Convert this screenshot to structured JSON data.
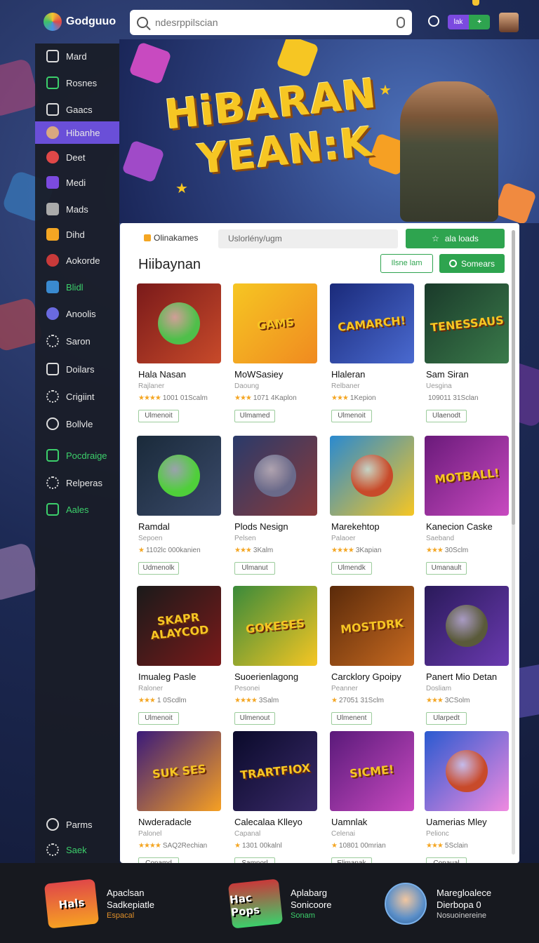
{
  "app": {
    "logo_text": "Godguuo"
  },
  "search": {
    "placeholder": "ndesrppilscian"
  },
  "topbar": {
    "pill_left": "lak",
    "pill_right": "+"
  },
  "sidebar": {
    "items": [
      {
        "label": "Mard",
        "icon": "home-icon"
      },
      {
        "label": "Rosnes",
        "icon": "monitor-icon"
      },
      {
        "label": "Gaacs",
        "icon": "house-icon"
      },
      {
        "label": "Hibanhe",
        "icon": "avatar-icon"
      },
      {
        "label": "Deet",
        "icon": "heart-icon"
      },
      {
        "label": "Medi",
        "icon": "dice-icon"
      },
      {
        "label": "Mads",
        "icon": "grid-icon"
      },
      {
        "label": "Dihd",
        "icon": "gift-icon"
      },
      {
        "label": "Aokorde",
        "icon": "rose-icon"
      },
      {
        "label": "Blidl",
        "icon": "blocks-icon"
      },
      {
        "label": "Anoolis",
        "icon": "heart-blue-icon"
      },
      {
        "label": "Saron",
        "icon": "gear-icon"
      },
      {
        "label": "Doilars",
        "icon": "list-icon"
      },
      {
        "label": "Crigiint",
        "icon": "settings-icon"
      },
      {
        "label": "Bollvle",
        "icon": "clock-icon"
      },
      {
        "label": "Pocdraige",
        "icon": "folder-icon"
      },
      {
        "label": "Relperas",
        "icon": "cog-icon"
      },
      {
        "label": "Aales",
        "icon": "chart-icon"
      },
      {
        "label": "Parms",
        "icon": "user-icon"
      },
      {
        "label": "Saek",
        "icon": "settings-icon"
      }
    ]
  },
  "hero": {
    "title_line1": "HiBARAN",
    "title_line2": "YEAN:K"
  },
  "panel": {
    "tab_label": "Olinakames",
    "filter_placeholder": "Uslorlény/ugm",
    "loads_button": "ala loads",
    "heading": "Hiibaynan",
    "outline_button": "Ilsne lam",
    "search_button": "Somears"
  },
  "games": [
    {
      "title": "Hala Nasan",
      "sub": "Rajlaner",
      "rating": "★★★★",
      "meta": "1001 01Scalm",
      "btn": "Ulmenoit",
      "art": "",
      "c1": "#7a1a1a",
      "c2": "#c84a2a",
      "blob": "#4fbf4a"
    },
    {
      "title": "MoWSasiey",
      "sub": "Daoung",
      "rating": "★★★",
      "meta": "1071 4Kaplon",
      "btn": "Ulmamed",
      "art": "GAMS",
      "c1": "#f6c623",
      "c2": "#f08a20",
      "blob": "#3a8ad0"
    },
    {
      "title": "Hlaleran",
      "sub": "Relbaner",
      "rating": "★★★",
      "meta": "1Kepion",
      "btn": "Ulmenoit",
      "art": "CAMARCH!",
      "c1": "#1a2a7a",
      "c2": "#4a6ad0",
      "blob": "#d04040"
    },
    {
      "title": "Sam Siran",
      "sub": "Uesgina",
      "rating": "",
      "meta": "109011 31Sclan",
      "btn": "Ulaenodt",
      "art": "TENESSAUS",
      "c1": "#1a3a2a",
      "c2": "#3a7a4a",
      "blob": "#7a5a3a"
    },
    {
      "title": "Ramdal",
      "sub": "Sepoen",
      "rating": "★",
      "meta": "1102lc 000kanien",
      "btn": "Udmenolk",
      "art": "",
      "c1": "#1a2a3a",
      "c2": "#3a4a6a",
      "blob": "#4fcf3a"
    },
    {
      "title": "Plods Nesign",
      "sub": "Pelsen",
      "rating": "★★★",
      "meta": "3Kalm",
      "btn": "Ulmanut",
      "art": "",
      "c1": "#2a3a6a",
      "c2": "#8a3a3a",
      "blob": "#6a6a8a"
    },
    {
      "title": "Marekehtop",
      "sub": "Palaoer",
      "rating": "★★★★",
      "meta": "3Kapian",
      "btn": "Ulmendk",
      "art": "",
      "c1": "#2a8ad0",
      "c2": "#f6c623",
      "blob": "#c84a2a"
    },
    {
      "title": "Kanecion Caske",
      "sub": "Saeband",
      "rating": "★★★",
      "meta": "30Sclm",
      "btn": "Umanault",
      "art": "MOTBALL!",
      "c1": "#6a1a7a",
      "c2": "#c84ac0",
      "blob": "#f6c623"
    },
    {
      "title": "Imualeg Pasle",
      "sub": "Raloner",
      "rating": "★★★",
      "meta": "1 0Scdlm",
      "btn": "Ulmenoit",
      "art": "SKAPR ALAYCOD",
      "c1": "#1a1a1a",
      "c2": "#7a1a1a",
      "blob": "#c84a2a"
    },
    {
      "title": "Suoerienlagong",
      "sub": "Pesonei",
      "rating": "★★★★",
      "meta": "3Salm",
      "btn": "Ulmenout",
      "art": "GOKESES",
      "c1": "#3a8a3a",
      "c2": "#f6c623",
      "blob": "#3a9a6a"
    },
    {
      "title": "Carcklory Gpoipy",
      "sub": "Peanner",
      "rating": "★",
      "meta": "27051 31Sclm",
      "btn": "Ulmenent",
      "art": "MOSTDRK",
      "c1": "#5a2a0a",
      "c2": "#c86a20",
      "blob": "#3a2a1a"
    },
    {
      "title": "Panert Mio Detan",
      "sub": "Dosliam",
      "rating": "★★★",
      "meta": "3CSolm",
      "btn": "Ularpedt",
      "art": "",
      "c1": "#2a1a5a",
      "c2": "#6a3ab0",
      "blob": "#5a5a3a"
    },
    {
      "title": "Nwderadacle",
      "sub": "Palonel",
      "rating": "★★★★",
      "meta": "SAQ2Rechian",
      "btn": "Conamd",
      "art": "SUK SES",
      "c1": "#3a1a7a",
      "c2": "#f6a023",
      "blob": "#6a3ac0"
    },
    {
      "title": "Calecalaa Klleyo",
      "sub": "Capanal",
      "rating": "★",
      "meta": "1301 00kalnl",
      "btn": "Samnorl",
      "art": "TRARTFIOX",
      "c1": "#0a0a2a",
      "c2": "#3a2a6a",
      "blob": "#c84a2a"
    },
    {
      "title": "Uamnlak",
      "sub": "Celenai",
      "rating": "★",
      "meta": "10801 00mrian",
      "btn": "Elimanak",
      "art": "SICME!",
      "c1": "#5a1a7a",
      "c2": "#c84ac0",
      "blob": "#f6c623"
    },
    {
      "title": "Uamerias Mley",
      "sub": "Pelionc",
      "rating": "★★★",
      "meta": "5Sclain",
      "btn": "Conaual",
      "art": "",
      "c1": "#2a5ad0",
      "c2": "#f08ae0",
      "blob": "#c84a2a"
    }
  ],
  "promos": [
    {
      "art": "Hals",
      "l1": "Apaclsan",
      "l2": "Sadkepiatle",
      "l3": "Espacal",
      "l3_color": "#e0902a"
    },
    {
      "art": "Hac Pops",
      "l1": "Aplabarg",
      "l2": "Sonicoore",
      "l3": "Sonam",
      "l3_color": "#3ccf6b"
    },
    {
      "art": "",
      "l1": "Maregloalece",
      "l2": "Dierbopa 0",
      "l3": "Nosuoinereine",
      "l3_color": "#cfcfcf"
    }
  ]
}
